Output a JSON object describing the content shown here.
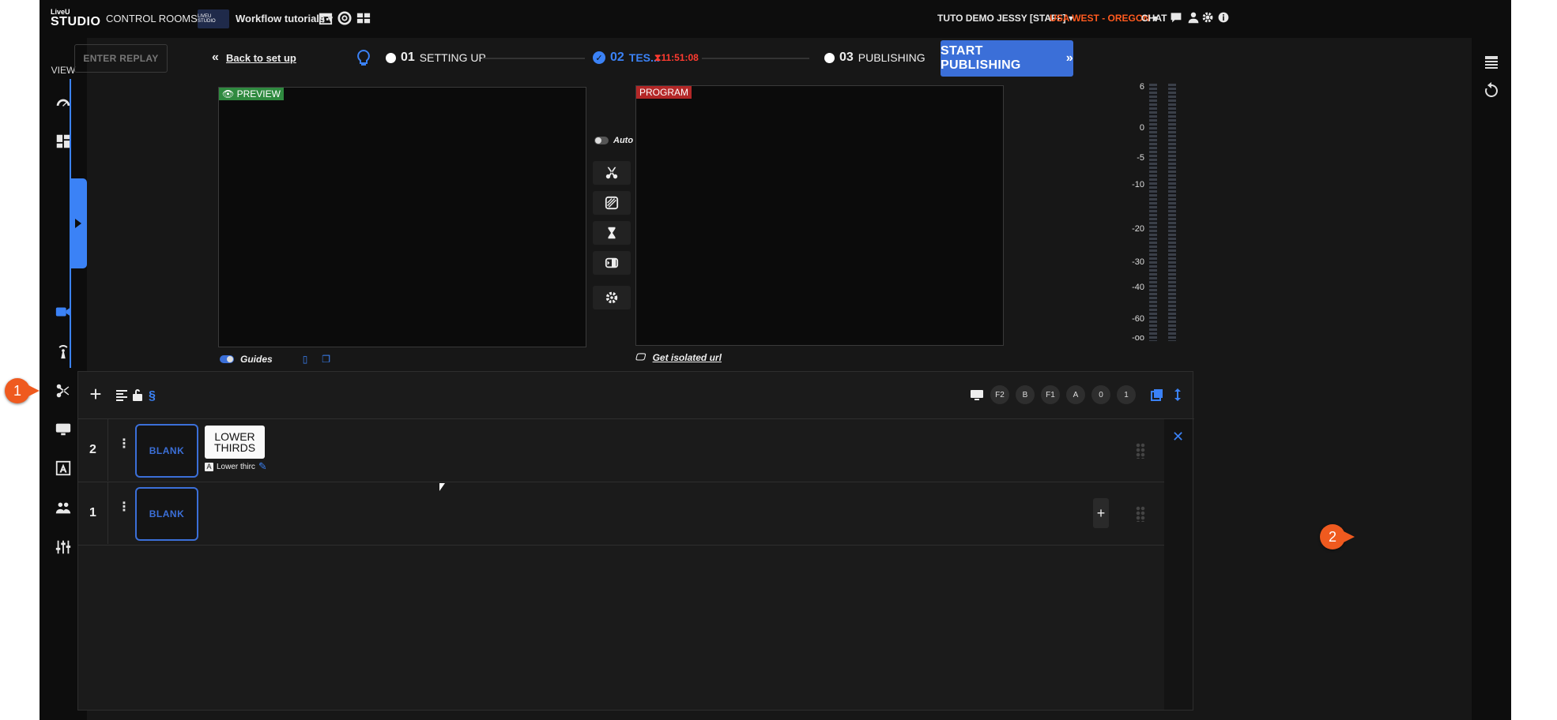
{
  "topbar": {
    "logo_top": "LiveU",
    "logo_bottom": "STUDIO",
    "control_rooms": "CONTROL ROOMS",
    "thumb_label": "LIVEU STUDIO",
    "workflow": "Workflow tutorials",
    "user": "TUTO DEMO JESSY [STAFF]",
    "region": "USA WEST - OREGON",
    "chat": "CHAT"
  },
  "nav": {
    "view_label": "VIEW"
  },
  "header": {
    "replay": "ENTER REPLAY",
    "back": "Back to set up",
    "step1_num": "01",
    "step1_label": "SETTING UP",
    "step2_num": "02",
    "step2_label": "TES...",
    "timer": "11:51:08",
    "step3_num": "03",
    "step3_label": "PUBLISHING",
    "publish": "START PUBLISHING"
  },
  "preview": {
    "label": "PREVIEW",
    "guides": "Guides"
  },
  "program": {
    "label": "PROGRAM",
    "isolated": "Get isolated url"
  },
  "controls": {
    "auto": "Auto"
  },
  "meter": {
    "scale": [
      "6",
      "0",
      "-5",
      "-10",
      "-20",
      "-30",
      "-40",
      "-60",
      "-oo"
    ]
  },
  "layers": {
    "keys": [
      "F2",
      "B",
      "F1",
      "A",
      "0",
      "1"
    ],
    "rows": [
      {
        "num": "2",
        "blank": "BLANK",
        "tile_line1": "LOWER",
        "tile_line2": "THIRDS",
        "caption": "Lower thirc"
      },
      {
        "num": "1",
        "blank": "BLANK"
      }
    ]
  },
  "callouts": {
    "one": "1",
    "two": "2"
  },
  "colors": {
    "accent": "#3b82f6",
    "publish": "#3b6fd8",
    "region": "#ff5a1f",
    "preview": "#2f8a3f",
    "program": "#b32727",
    "callout": "#ef5a1f"
  }
}
